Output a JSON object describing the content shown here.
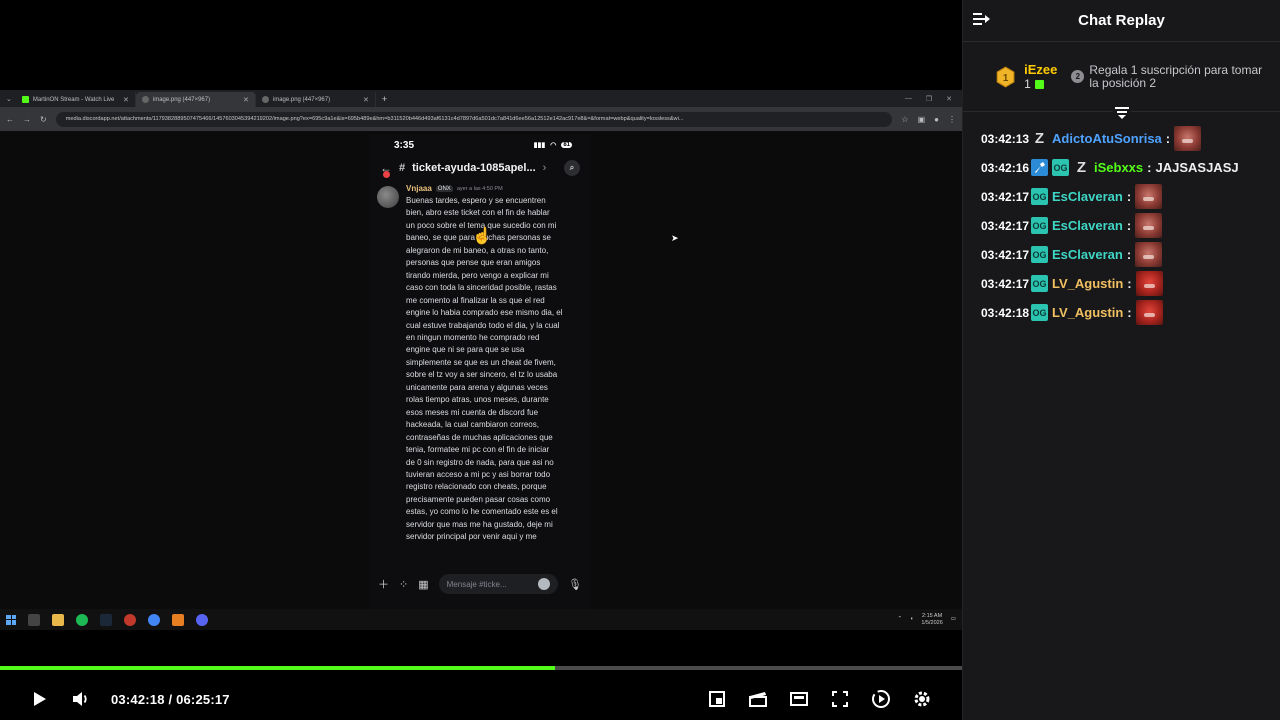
{
  "browser": {
    "tabs": [
      {
        "label": "MartinON Stream - Watch Live",
        "active": false
      },
      {
        "label": "image.png (447×967)",
        "active": true
      },
      {
        "label": "image.png (447×967)",
        "active": false
      }
    ],
    "url": "media.discordapp.net/attachments/1179382889507475466/1457603045394219202/image.png?ex=695c9a1e&is=695b489e&hm=b311520b446d493af6131c4d7897d6a501dc7a841d6ee56a12512e142ac917e8&=&format=webp&quality=lossless&wi..."
  },
  "phone": {
    "clock": "3:35",
    "battery": "81",
    "channel": "ticket-ayuda-1085apel...",
    "message": {
      "author": "Vnjaaa",
      "tag": "ONX",
      "time": "ayer a las 4:50 PM",
      "text": "Buenas tardes, espero y se encuentren\nbien, abro este ticket con el fin de hablar\nun poco sobre el tema que sucedio con mi\nbaneo, se que para muchas personas se\nalegraron de mi baneo, a otras no tanto,\npersonas que pense que eran amigos\ntirando mierda, pero vengo a explicar mi\ncaso con toda la sinceridad posible, rastas\nme comento al finalizar la ss que el red\nengine lo habia comprado ese mismo dia, el\ncual estuve trabajando todo el dia, y la cual\nen ningun momento he comprado red\nengine que ni se para que se usa\nsimplemente se que es un cheat de fivem,\nsobre el tz voy a ser sincero, el tz lo usaba\nunicamente para arena y algunas veces\nrolas tiempo atras, unos meses, durante\nesos meses mi cuenta de discord fue\nhackeada, la cual cambiaron correos,\ncontraseñas de muchas aplicaciones que\ntenia, formatee mi pc con el fin de iniciar\nde 0 sin registro de nada, para que asi no\ntuvieran acceso a mi pc y asi borrar todo\nregistro relacionado con cheats, porque\nprecisamente pueden pasar cosas como\nestas, yo como lo he comentado este es el\nservidor que mas me ha gustado, deje mi\nservidor principal por venir aqui y me"
    },
    "composer_placeholder": "Mensaje #ticke..."
  },
  "taskbar": {
    "clock_time": "2:15 AM",
    "clock_date": "1/5/2026"
  },
  "player": {
    "progress": 0.577,
    "current_time": "03:42:18",
    "total_time": "06:25:17",
    "time_display": "03:42:18 / 06:25:17",
    "accent": "#53fc18"
  },
  "chat": {
    "title": "Chat Replay",
    "leaderboard": {
      "rank": "1",
      "user": "iEzee",
      "count": "1",
      "next_rank": "2",
      "cta": "Regala 1 suscripción para tomar la posición 2"
    },
    "messages": [
      {
        "time": "03:42:13",
        "badges": [
          "z"
        ],
        "user": "AdictoAtuSonrisa",
        "color": "#4fa3ff",
        "text": "",
        "emote": "red-face"
      },
      {
        "time": "03:42:16",
        "badges": [
          "vip",
          "og",
          "z"
        ],
        "user": "iSebxxs",
        "color": "#53fc18",
        "text": "JAJSASJASJ",
        "emote": ""
      },
      {
        "time": "03:42:17",
        "badges": [
          "og"
        ],
        "user": "EsClaveran",
        "color": "#3ed6c5",
        "text": "",
        "emote": "red-face"
      },
      {
        "time": "03:42:17",
        "badges": [
          "og"
        ],
        "user": "EsClaveran",
        "color": "#3ed6c5",
        "text": "",
        "emote": "red-face"
      },
      {
        "time": "03:42:17",
        "badges": [
          "og"
        ],
        "user": "EsClaveran",
        "color": "#3ed6c5",
        "text": "",
        "emote": "red-face"
      },
      {
        "time": "03:42:17",
        "badges": [
          "og"
        ],
        "user": "LV_Agustin",
        "color": "#f0c060",
        "text": "",
        "emote": "angry-red-face"
      },
      {
        "time": "03:42:18",
        "badges": [
          "og"
        ],
        "user": "LV_Agustin",
        "color": "#f0c060",
        "text": "",
        "emote": "angry-red-face"
      }
    ]
  }
}
